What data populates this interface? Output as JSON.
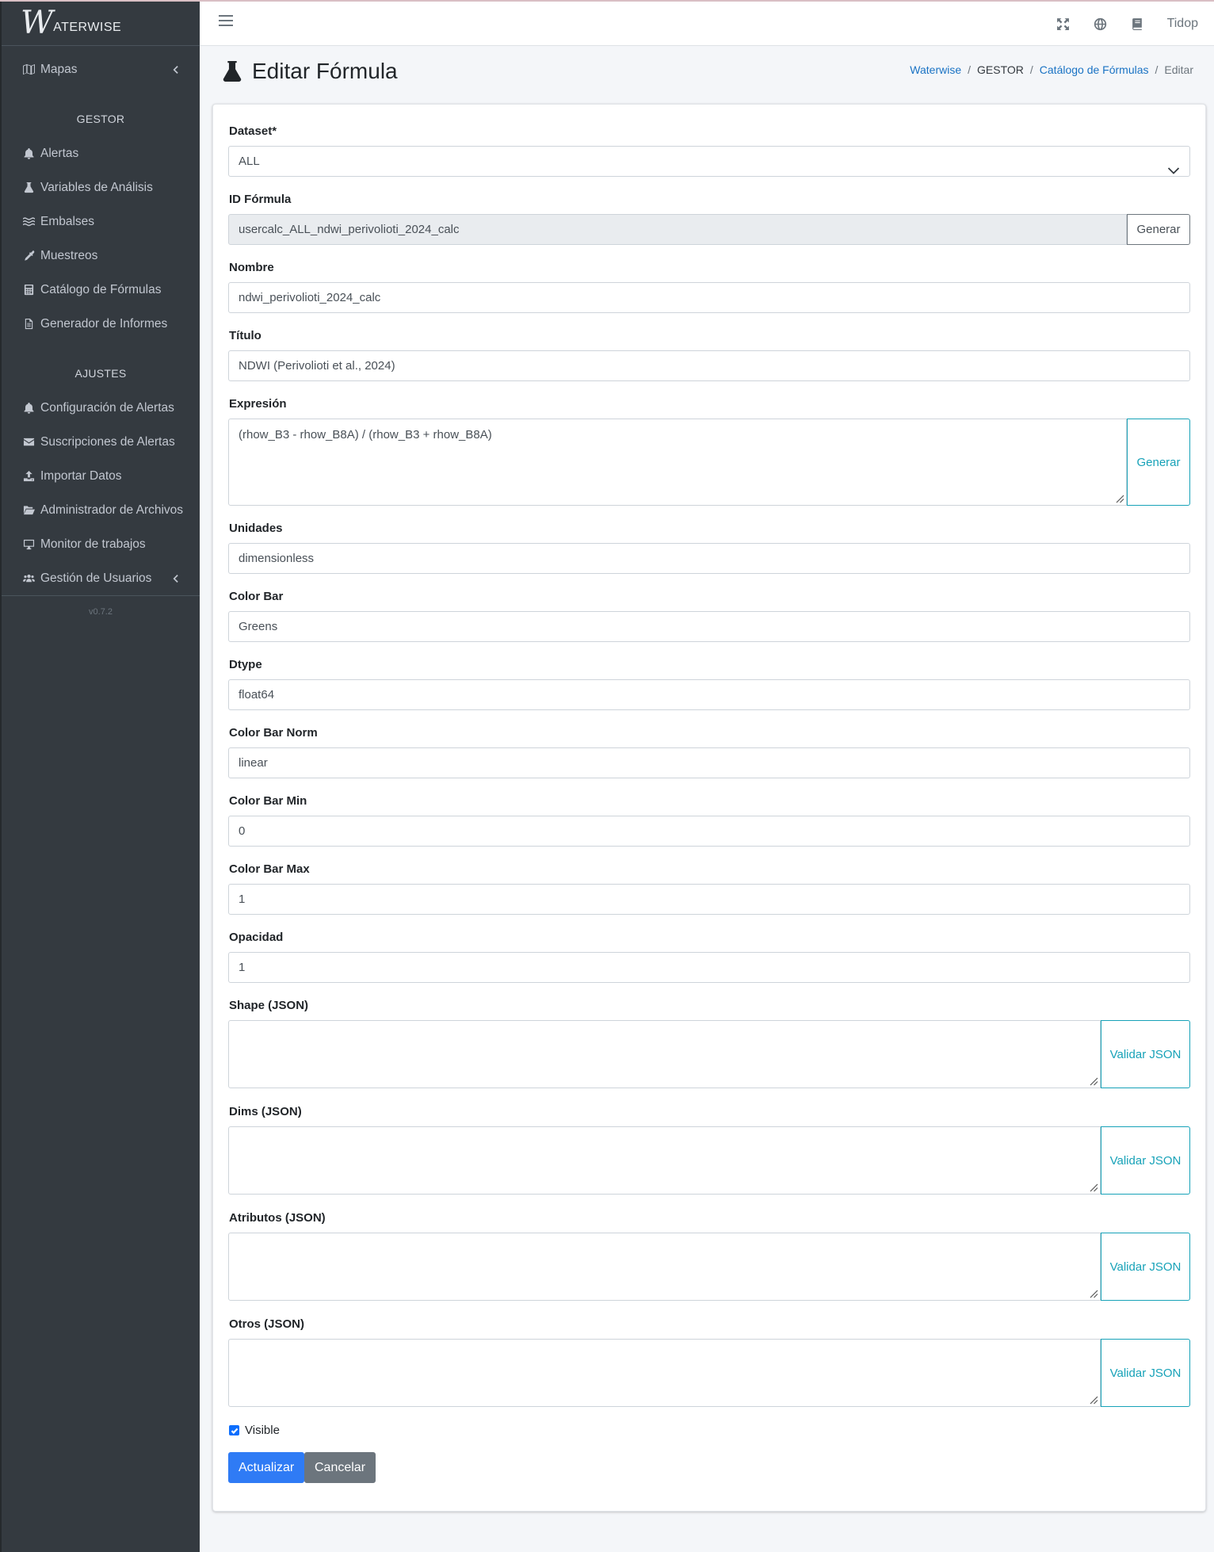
{
  "brand": {
    "mark": "W",
    "name": "ATERWISE"
  },
  "sidebar": {
    "top_items": [
      {
        "label": "Mapas",
        "icon": "map-icon"
      }
    ],
    "section_gestor": "GESTOR",
    "gestor_items": [
      {
        "label": "Alertas",
        "icon": "bell-icon"
      },
      {
        "label": "Variables de Análisis",
        "icon": "flask-icon"
      },
      {
        "label": "Embalses",
        "icon": "water-icon"
      },
      {
        "label": "Muestreos",
        "icon": "eyedropper-icon"
      },
      {
        "label": "Catálogo de Fórmulas",
        "icon": "calculator-icon"
      },
      {
        "label": "Generador de Informes",
        "icon": "file-icon"
      }
    ],
    "section_ajustes": "AJUSTES",
    "ajustes_items": [
      {
        "label": "Configuración de Alertas",
        "icon": "bell-icon"
      },
      {
        "label": "Suscripciones de Alertas",
        "icon": "envelope-icon"
      },
      {
        "label": "Importar Datos",
        "icon": "upload-icon"
      },
      {
        "label": "Administrador de Archivos",
        "icon": "folder-open-icon"
      },
      {
        "label": "Monitor de trabajos",
        "icon": "desktop-icon"
      },
      {
        "label": "Gestión de Usuarios",
        "icon": "users-icon"
      }
    ],
    "version": "v0.7.2"
  },
  "navbar": {
    "user": "Tidop",
    "icons": [
      "expand-icon",
      "globe-icon",
      "book-icon"
    ]
  },
  "header": {
    "title": "Editar Fórmula",
    "breadcrumb": [
      "Waterwise",
      "GESTOR",
      "Catálogo de Fórmulas",
      "Editar"
    ]
  },
  "form": {
    "dataset": {
      "label": "Dataset*",
      "value": "ALL"
    },
    "id_formula": {
      "label": "ID Fórmula",
      "value": "usercalc_ALL_ndwi_perivolioti_2024_calc",
      "button": "Generar"
    },
    "nombre": {
      "label": "Nombre",
      "value": "ndwi_perivolioti_2024_calc"
    },
    "titulo": {
      "label": "Título",
      "value": "NDWI (Perivolioti et al., 2024)"
    },
    "expresion": {
      "label": "Expresión",
      "value": "(rhow_B3 - rhow_B8A) / (rhow_B3 + rhow_B8A)",
      "button": "Generar"
    },
    "unidades": {
      "label": "Unidades",
      "value": "dimensionless"
    },
    "color_bar": {
      "label": "Color Bar",
      "value": "Greens"
    },
    "dtype": {
      "label": "Dtype",
      "value": "float64"
    },
    "color_bar_norm": {
      "label": "Color Bar Norm",
      "value": "linear"
    },
    "color_bar_min": {
      "label": "Color Bar Min",
      "value": "0"
    },
    "color_bar_max": {
      "label": "Color Bar Max",
      "value": "1"
    },
    "opacidad": {
      "label": "Opacidad",
      "value": "1"
    },
    "shape": {
      "label": "Shape (JSON)",
      "value": "",
      "button": "Validar JSON"
    },
    "dims": {
      "label": "Dims (JSON)",
      "value": "",
      "button": "Validar JSON"
    },
    "atributos": {
      "label": "Atributos (JSON)",
      "value": "",
      "button": "Validar JSON"
    },
    "otros": {
      "label": "Otros (JSON)",
      "value": "",
      "button": "Validar JSON"
    },
    "visible": {
      "label": "Visible",
      "checked": true
    },
    "submit_label": "Actualizar",
    "cancel_label": "Cancelar"
  },
  "colors": {
    "primary": "#2f7bf5",
    "info": "#17a2b8",
    "sidebar_bg": "#343a40",
    "link": "#1a73c4"
  }
}
